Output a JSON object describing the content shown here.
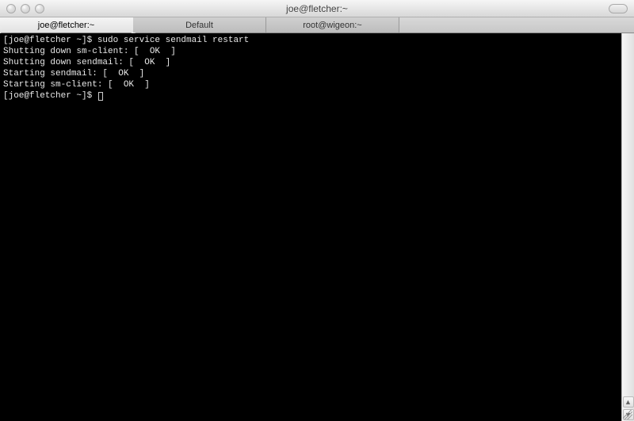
{
  "window": {
    "title": "joe@fletcher:~"
  },
  "tabs": [
    {
      "label": "joe@fletcher:~",
      "active": true
    },
    {
      "label": "Default",
      "active": false
    },
    {
      "label": "root@wigeon:~",
      "active": false
    }
  ],
  "terminal": {
    "lines": [
      "[joe@fletcher ~]$ sudo service sendmail restart",
      "Shutting down sm-client: [  OK  ]",
      "Shutting down sendmail: [  OK  ]",
      "Starting sendmail: [  OK  ]",
      "Starting sm-client: [  OK  ]"
    ],
    "prompt": "[joe@fletcher ~]$ "
  },
  "scroll": {
    "up": "▲",
    "down": "▼"
  }
}
